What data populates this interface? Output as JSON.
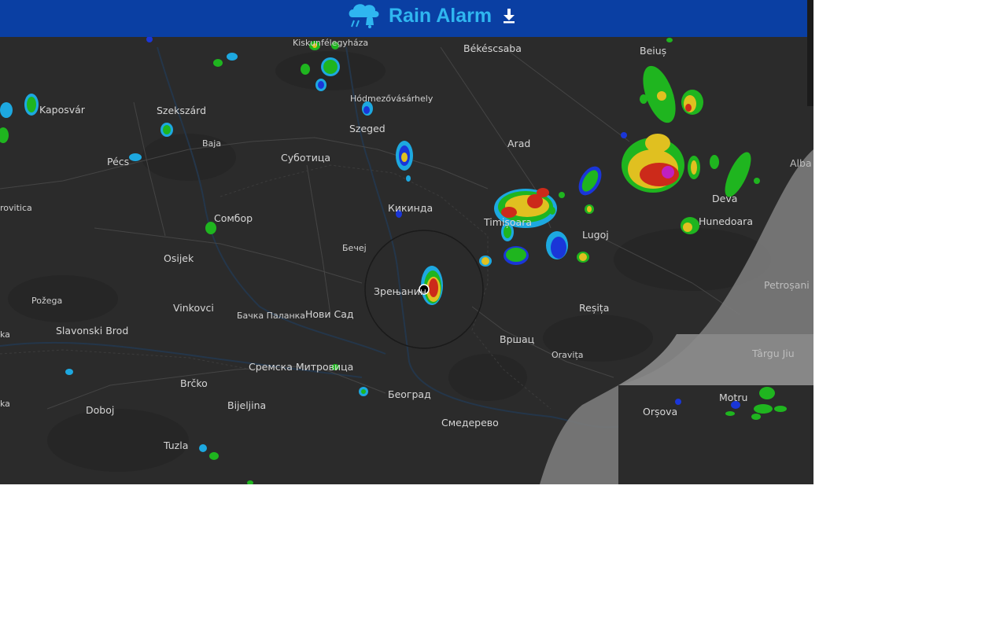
{
  "header": {
    "title": "Rain Alarm",
    "logo_icon": "cloud-rain-bell-icon",
    "download_icon": "download-icon"
  },
  "map": {
    "labels": {
      "kiskunfelegyhaza": "Kiskunfélegyháza",
      "bekescsaba": "Békéscsaba",
      "beius": "Beiuș",
      "kaposvar": "Kaposvár",
      "szekszard": "Szekszárd",
      "hodmezovasarhely": "Hódmezővásárhely",
      "szeged": "Szeged",
      "baja": "Baja",
      "arad": "Arad",
      "pecs": "Pécs",
      "subotica": "Суботица",
      "alba": "Alba",
      "deva": "Deva",
      "virovitica": "rovitica",
      "kikinda": "Кикинда",
      "sombor": "Сомбор",
      "timisoara": "Timișoara",
      "hunedoara": "Hunedoara",
      "lugoj": "Lugoj",
      "becej": "Бечеј",
      "osijek": "Osijek",
      "petrosani": "Petroșani",
      "zrenjanin": "Зрењанин",
      "pozega": "Požega",
      "vinkovci": "Vinkovci",
      "backa_palanka": "Бачка Паланка",
      "novi_sad": "Нови Сад",
      "resita": "Reșița",
      "slavonski_brod": "Slavonski Brod",
      "ka1": "ka",
      "vrsac": "Вршац",
      "oravita": "Oravița",
      "targu_jiu": "Târgu Jiu",
      "sremska_mitrovica": "Сремска Митровица",
      "brcko": "Brčko",
      "beograd": "Београд",
      "motru": "Motru",
      "ka2": "ka",
      "bijeljina": "Bijeljina",
      "orsova": "Orșova",
      "doboj": "Doboj",
      "smederevo": "Смедерево",
      "tuzla": "Tuzla"
    }
  },
  "colors": {
    "header_bg": "#0a3fa3",
    "title": "#2fb6f0",
    "map_bg": "#2b2b2b",
    "coverage_mask": "#7b7b7b",
    "rain_light": "#1da8e0",
    "rain_moderate": "#1fb51f",
    "rain_heavy": "#e0c020",
    "rain_very_heavy": "#cc2a1a",
    "rain_extreme": "#c020c0"
  }
}
